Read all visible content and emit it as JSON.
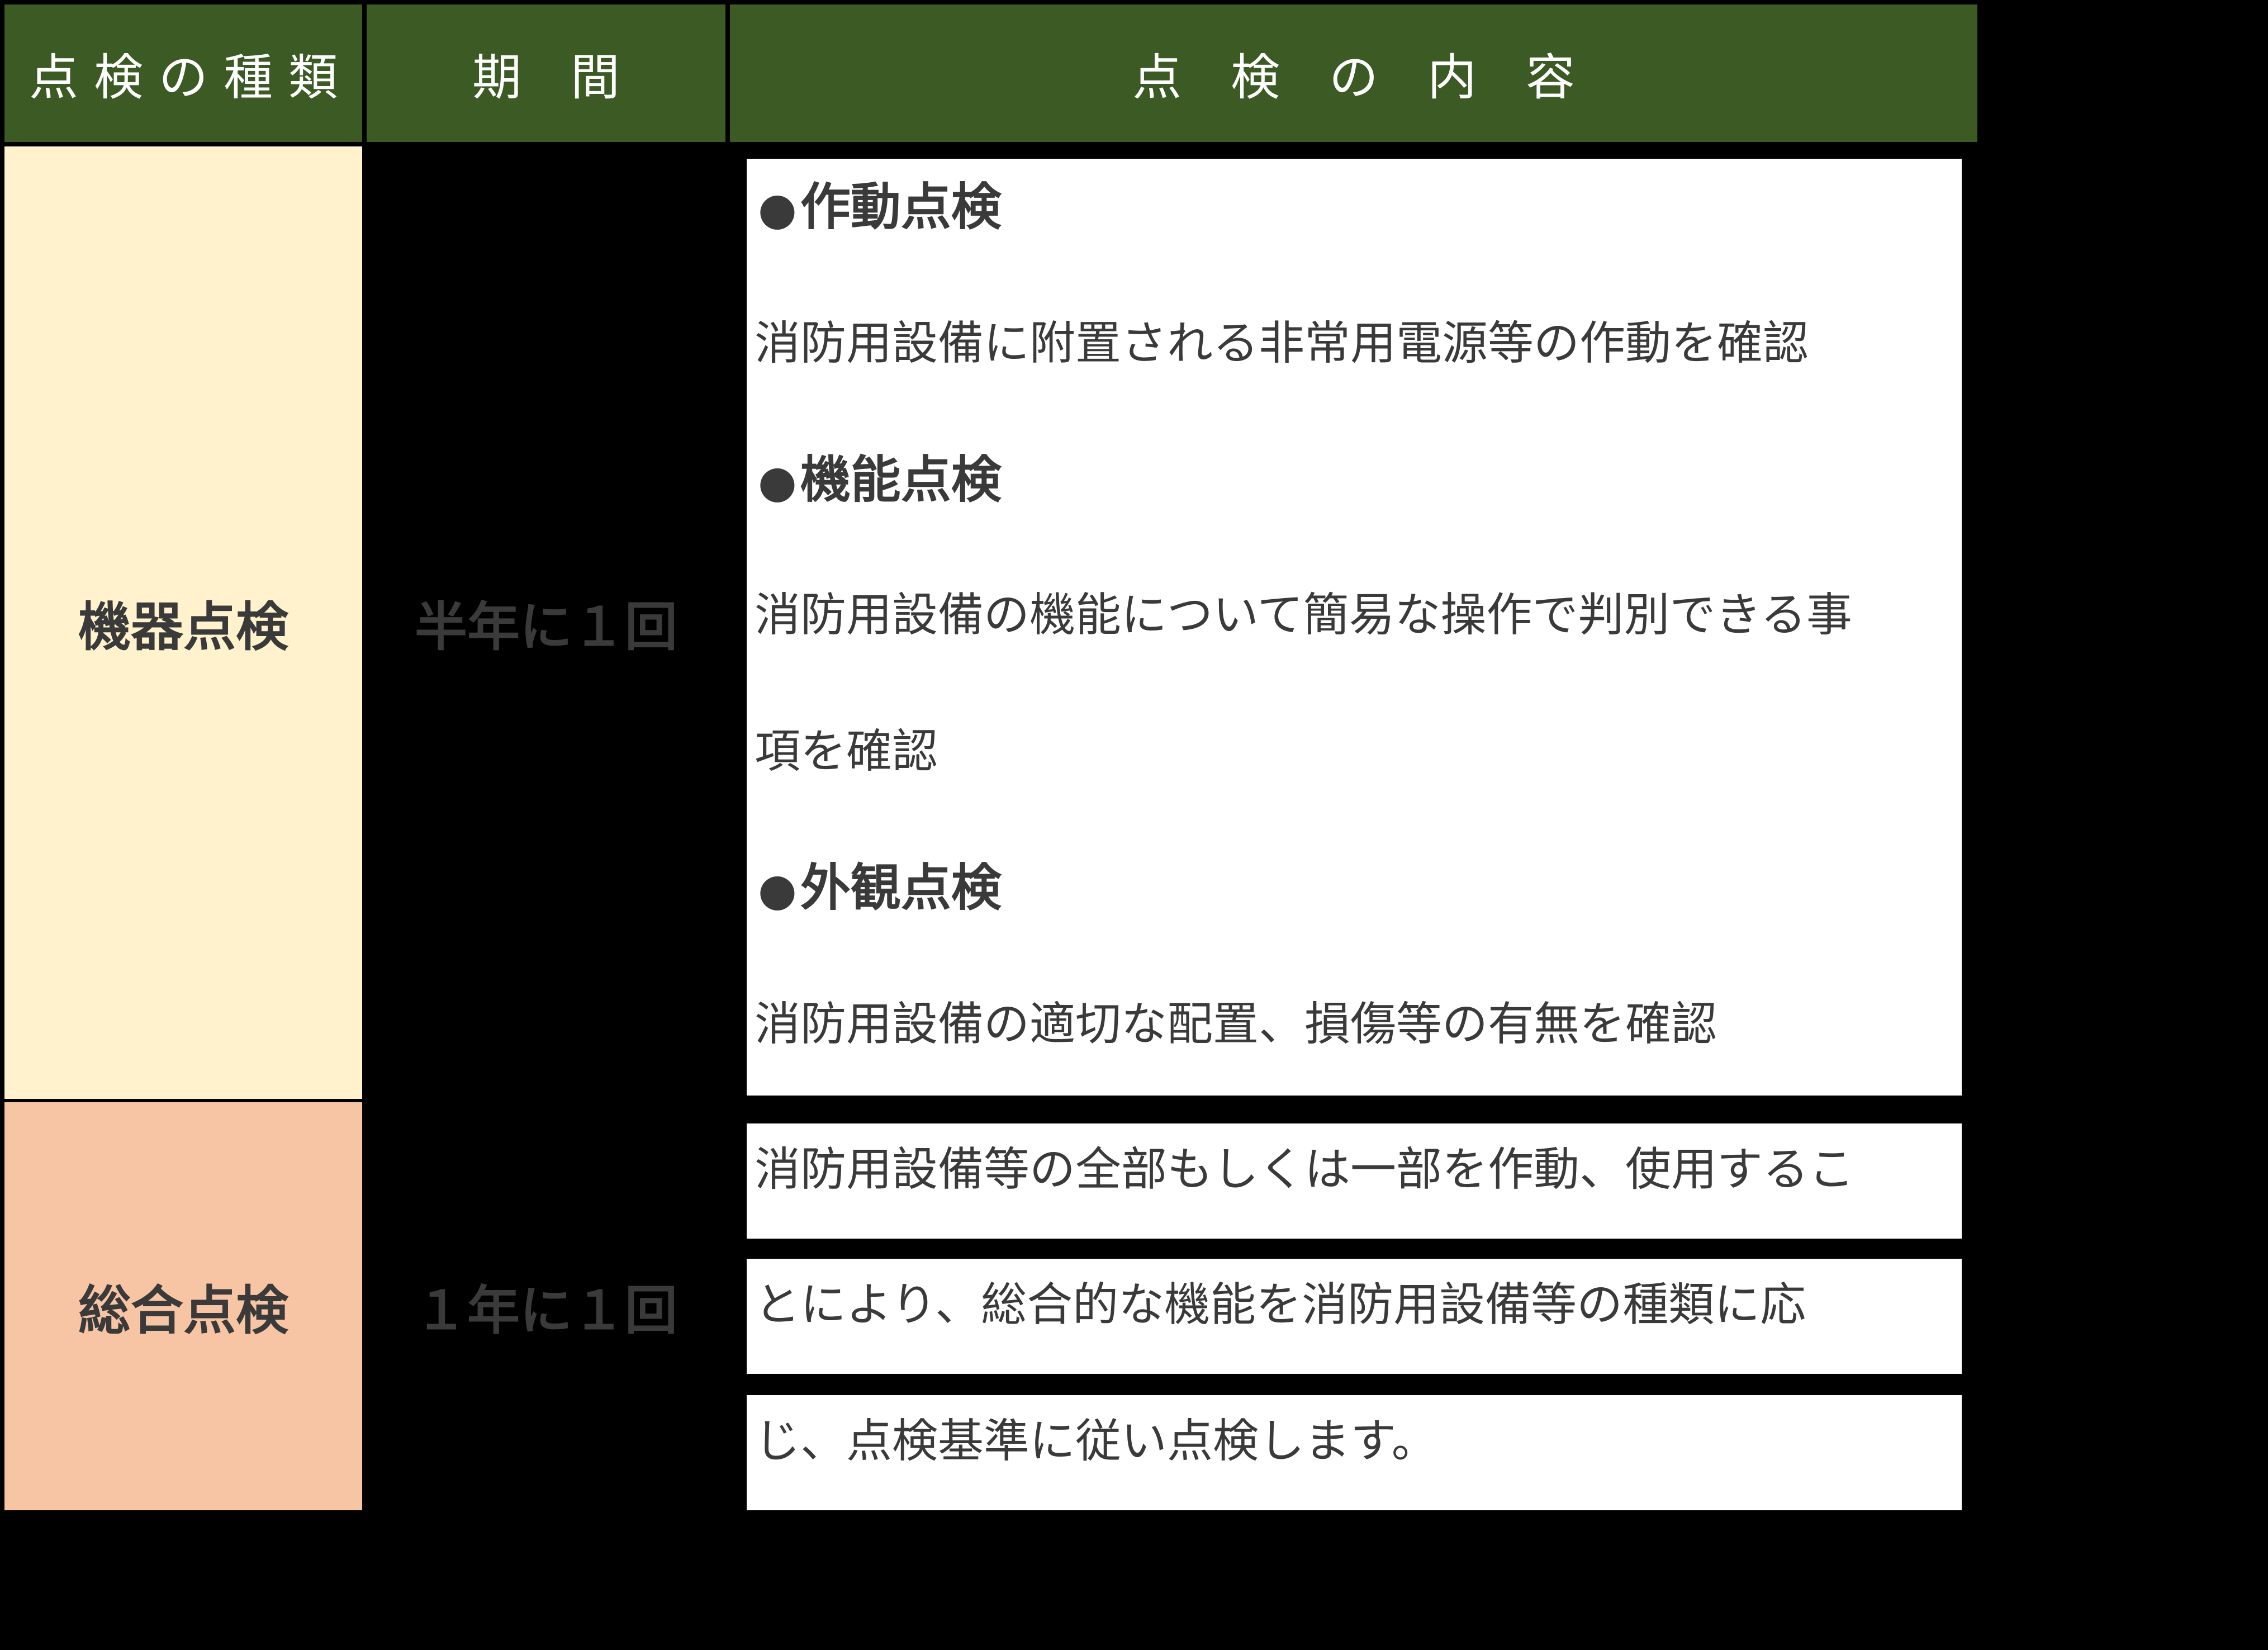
{
  "header": {
    "type_label": "点 検 の 種 類",
    "period_label": "期　間",
    "content_label": "点　検　の　内　容"
  },
  "rows": [
    {
      "type": "機器点検",
      "period": "半年に１回",
      "items": [
        {
          "heading": "作動点検",
          "text": [
            "消防用設備に附置される非常用電源等の作動を確認"
          ]
        },
        {
          "heading": "機能点検",
          "text": [
            "消防用設備の機能について簡易な操作で判別できる事",
            "項を確認"
          ]
        },
        {
          "heading": "外観点検",
          "text": [
            "消防用設備の適切な配置、損傷等の有無を確認"
          ]
        }
      ]
    },
    {
      "type": "総合点検",
      "period": "１年に１回",
      "lines": [
        "消防用設備等の全部もしくは一部を作動、使用するこ",
        "とにより、総合的な機能を消防用設備等の種類に応",
        "じ、点検基準に従い点検します。"
      ]
    }
  ],
  "bullet_char": "●",
  "colors": {
    "header_bg": "#3b5a24",
    "row1_type_bg": "#fff2cc",
    "row2_type_bg": "#f8c5a4",
    "text": "#3a3a3a",
    "background": "#000000"
  }
}
